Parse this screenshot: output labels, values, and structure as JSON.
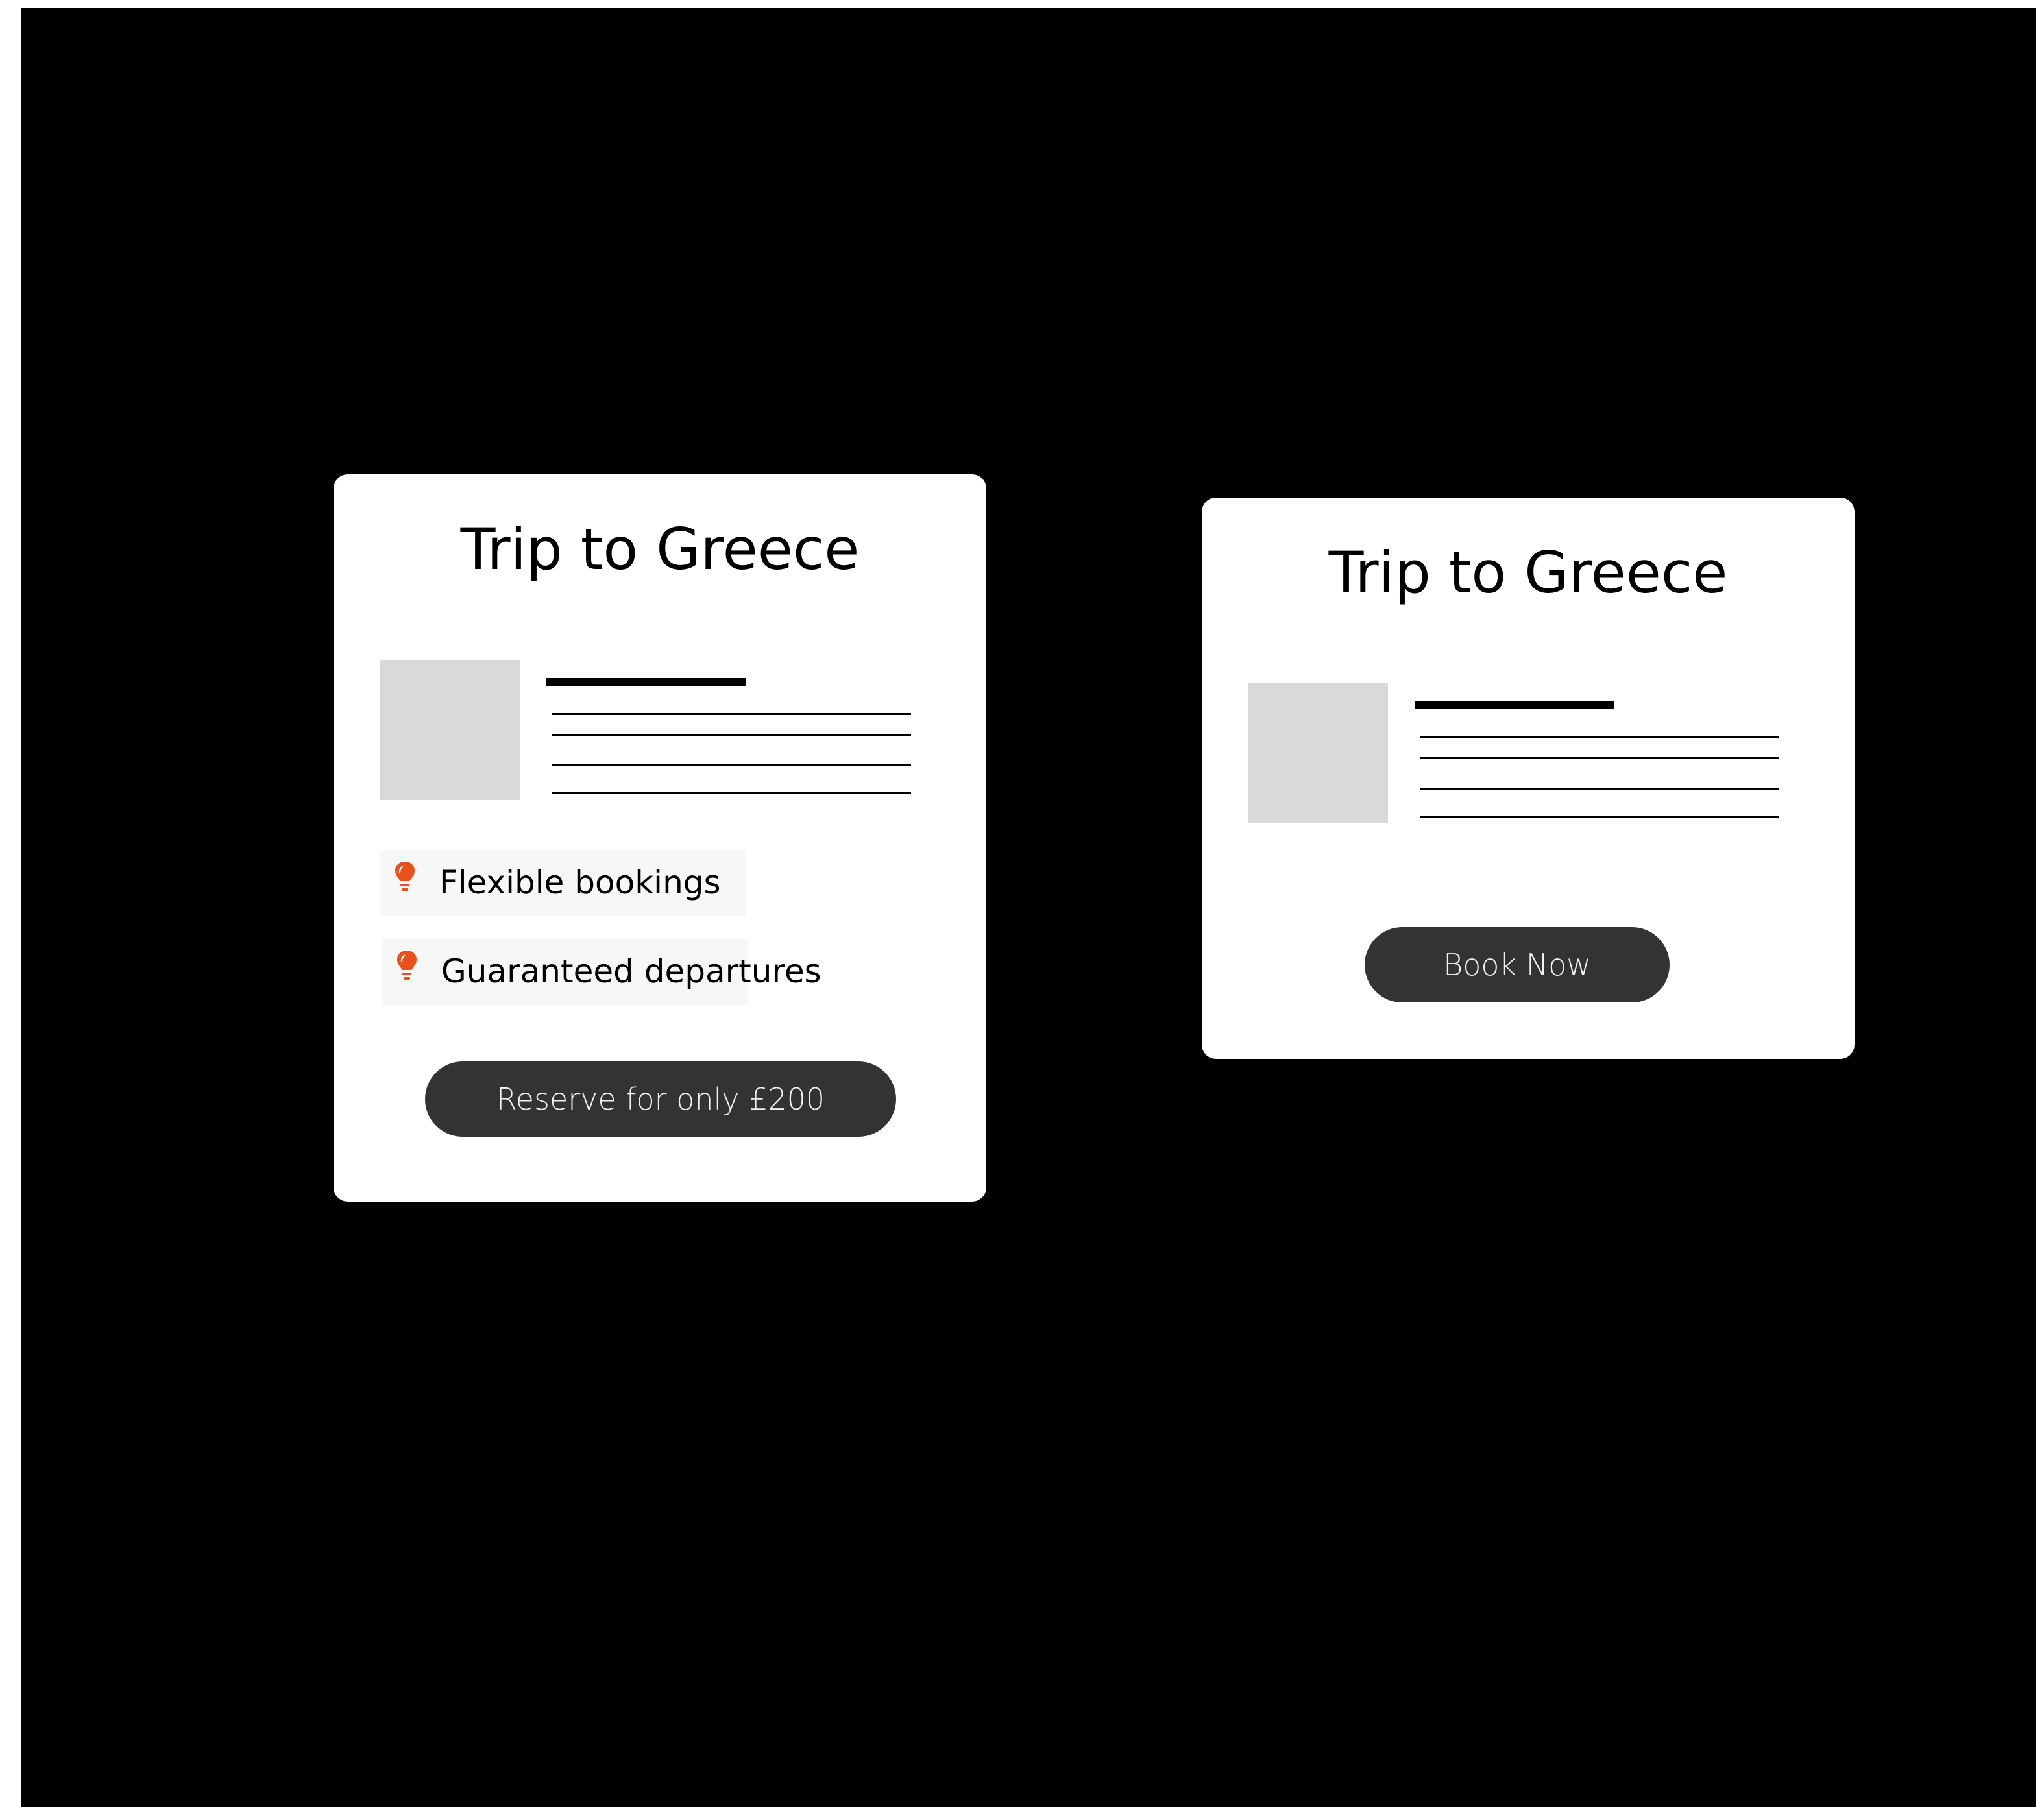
{
  "cards": [
    {
      "title": "Trip to Greece",
      "features": [
        {
          "label": "Flexible bookings",
          "icon": "lightbulb-icon"
        },
        {
          "label": "Guaranteed departures",
          "icon": "lightbulb-icon"
        }
      ],
      "button_label": "Reserve for only £200"
    },
    {
      "title": "Trip to Greece",
      "button_label": "Book Now"
    }
  ],
  "colors": {
    "background": "#000000",
    "card": "#ffffff",
    "button": "#333333",
    "button_text": "#f2f2f2",
    "icon_accent": "#e8501c",
    "placeholder_image": "#d9d9d9"
  }
}
